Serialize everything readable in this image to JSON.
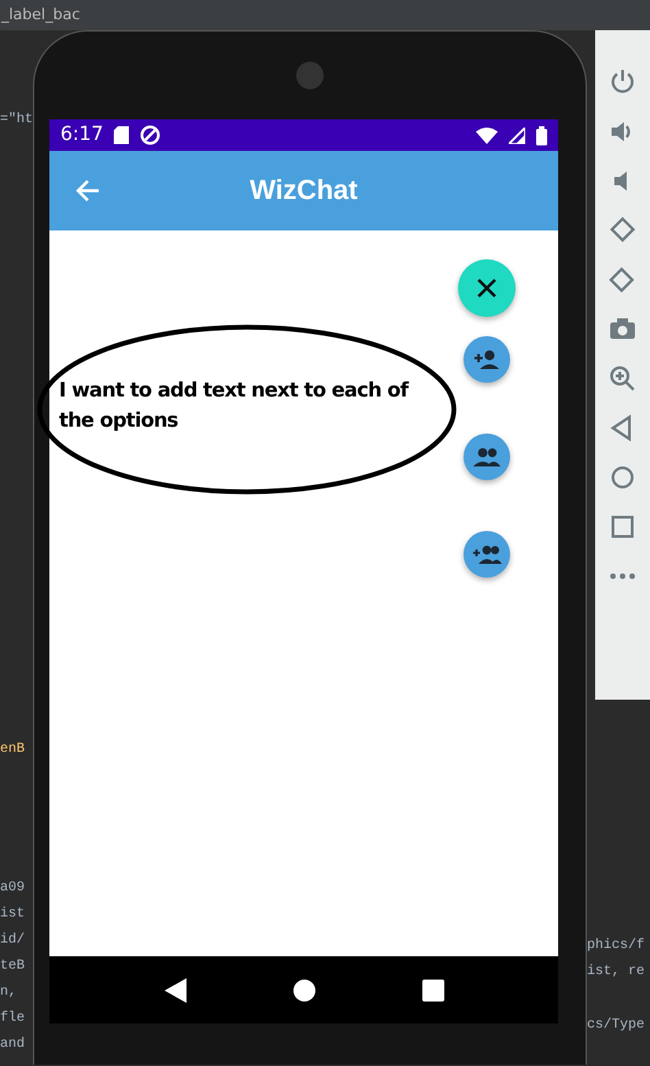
{
  "ide": {
    "tab_title": "_label_bac",
    "left_code": [
      {
        "text": "=\"ht",
        "kind": "plain"
      },
      {
        "text": "enB",
        "kind": "accent"
      },
      {
        "text": "a09",
        "kind": "plain"
      },
      {
        "text": "ist",
        "kind": "plain"
      },
      {
        "text": "id/",
        "kind": "plain"
      },
      {
        "text": "teB",
        "kind": "plain"
      },
      {
        "text": "n,",
        "kind": "plain"
      },
      {
        "text": "fle",
        "kind": "plain"
      },
      {
        "text": "and",
        "kind": "plain"
      }
    ],
    "right_code": [
      "phics/f",
      "ist, re",
      "cs/Type"
    ]
  },
  "status_bar": {
    "time": "6:17"
  },
  "app_bar": {
    "title": "WizChat"
  },
  "annotation": {
    "text": "I want to add text next to each of the options"
  },
  "fab_menu": {
    "expanded": true,
    "actions": [
      {
        "kind": "add-person"
      },
      {
        "kind": "group"
      },
      {
        "kind": "add-group"
      }
    ]
  }
}
